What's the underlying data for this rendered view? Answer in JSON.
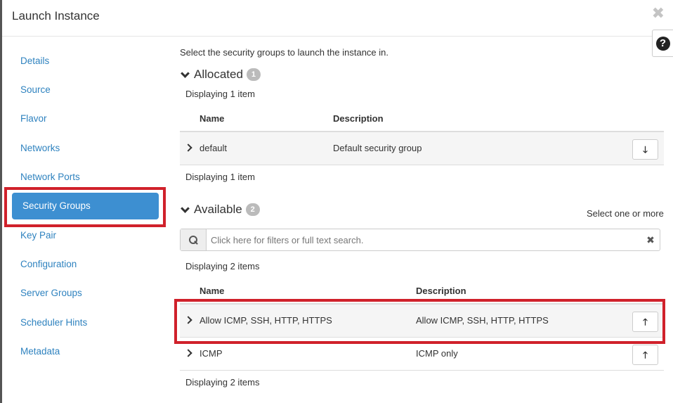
{
  "header": {
    "title": "Launch Instance",
    "close_glyph": "✖",
    "help_glyph": "?"
  },
  "sidebar": {
    "items": [
      {
        "label": "Details"
      },
      {
        "label": "Source"
      },
      {
        "label": "Flavor"
      },
      {
        "label": "Networks"
      },
      {
        "label": "Network Ports"
      },
      {
        "label": "Security Groups",
        "active": true
      },
      {
        "label": "Key Pair"
      },
      {
        "label": "Configuration"
      },
      {
        "label": "Server Groups"
      },
      {
        "label": "Scheduler Hints"
      },
      {
        "label": "Metadata"
      }
    ]
  },
  "main": {
    "intro": "Select the security groups to launch the instance in.",
    "allocated": {
      "title": "Allocated",
      "count": "1",
      "displaying_top": "Displaying 1 item",
      "displaying_bottom": "Displaying 1 item",
      "columns": [
        "Name",
        "Description"
      ],
      "rows": [
        {
          "name": "default",
          "description": "Default security group"
        }
      ]
    },
    "available": {
      "title": "Available",
      "count": "2",
      "select_hint": "Select one or more",
      "search_placeholder": "Click here for filters or full text search.",
      "displaying_top": "Displaying 2 items",
      "displaying_bottom": "Displaying 2 items",
      "columns": [
        "Name",
        "Description"
      ],
      "rows": [
        {
          "name": "Allow ICMP, SSH, HTTP, HTTPS",
          "description": "Allow ICMP, SSH, HTTP, HTTPS"
        },
        {
          "name": "ICMP",
          "description": "ICMP only"
        }
      ]
    }
  },
  "icons": {
    "arrow_down": "🡓",
    "arrow_up": "🡑",
    "clear": "✖"
  },
  "colors": {
    "accent": "#3d8fd1",
    "link": "#2e82bf",
    "highlight": "#d0212b"
  }
}
